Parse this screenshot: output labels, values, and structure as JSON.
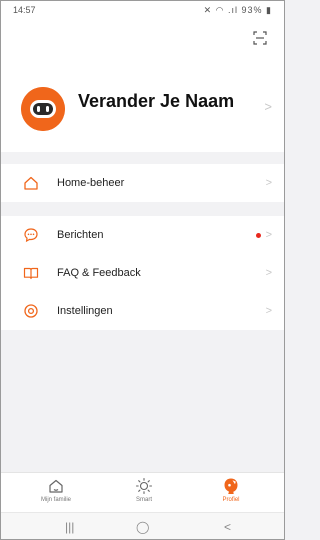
{
  "status_bar": {
    "time": "14:57",
    "indicators": "✕ ◠ .ıl 93% ▮"
  },
  "profile": {
    "name": "Verander Je Naam",
    "avatar_icon": "robot-avatar-icon"
  },
  "menu": {
    "home": {
      "label": "Home-beheer",
      "icon": "house-icon"
    },
    "messages": {
      "label": "Berichten",
      "icon": "chat-bubble-icon",
      "has_unread": true
    },
    "faq": {
      "label": "FAQ & Feedback",
      "icon": "book-icon"
    },
    "settings": {
      "label": "Instellingen",
      "icon": "settings-icon"
    }
  },
  "bottom_nav": {
    "tabs": [
      {
        "label": "Mijn familie",
        "icon": "home-tab-icon",
        "active": false
      },
      {
        "label": "Smart",
        "icon": "sun-icon",
        "active": false
      },
      {
        "label": "Profiel",
        "icon": "profile-tab-icon",
        "active": true
      }
    ]
  },
  "system_nav": {
    "recents": "|||",
    "home": "◯",
    "back": "<"
  },
  "colors": {
    "accent": "#f0661b",
    "badge": "#e8281e",
    "background": "#f2f2f4"
  }
}
